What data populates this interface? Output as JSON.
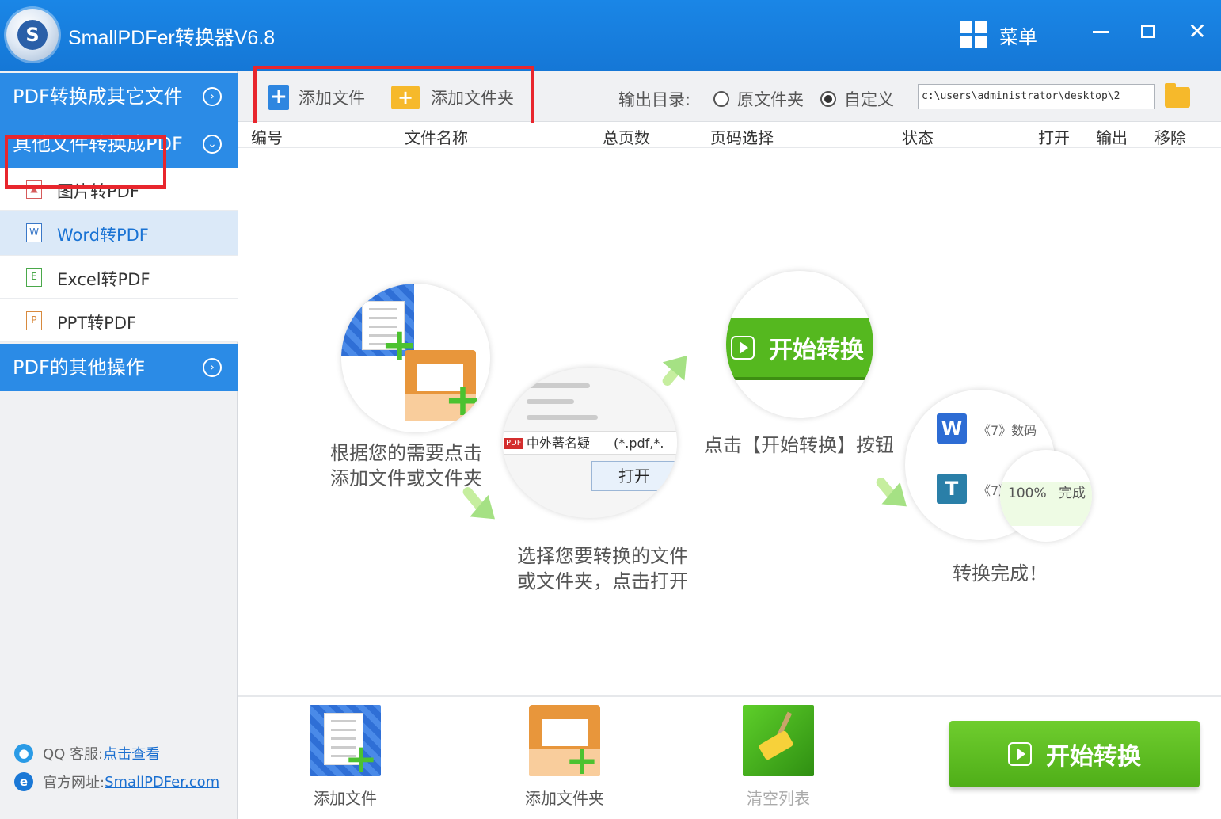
{
  "app": {
    "title": "SmallPDFer转换器V6.8",
    "logo_letter": "S",
    "menu_label": "菜单",
    "minimize": "",
    "maximize": "",
    "close": "✕"
  },
  "sidebar": {
    "categories": [
      {
        "label": "PDF转换成其它文件",
        "chevron": "›"
      },
      {
        "label": "其他文件转换成PDF",
        "chevron": "⌄"
      },
      {
        "label": "PDF的其他操作",
        "chevron": "›"
      }
    ],
    "items": [
      {
        "label": "图片转PDF",
        "icon": "image-file-icon"
      },
      {
        "label": "Word转PDF",
        "icon": "word-file-icon",
        "selected": true
      },
      {
        "label": "Excel转PDF",
        "icon": "excel-file-icon"
      },
      {
        "label": "PPT转PDF",
        "icon": "ppt-file-icon"
      }
    ],
    "footer": {
      "qq_label": "QQ 客服:",
      "qq_link": "点击查看",
      "site_label": "官方网址:",
      "site_link": "SmallPDFer.com"
    }
  },
  "toolbar": {
    "add_file": "添加文件",
    "add_folder": "添加文件夹",
    "output_label": "输出目录:",
    "radio_original": "原文件夹",
    "radio_custom": "自定义",
    "selected_radio": "自定义",
    "output_path": "c:\\users\\administrator\\desktop\\2"
  },
  "table": {
    "columns": [
      "编号",
      "文件名称",
      "总页数",
      "页码选择",
      "状态",
      "打开",
      "输出",
      "移除"
    ]
  },
  "guide": {
    "step1": [
      "根据您的需要点击",
      "添加文件或文件夹"
    ],
    "step2": [
      "选择您要转换的文件",
      "或文件夹，点击打开"
    ],
    "step3": "点击【开始转换】按钮",
    "step4": "转换完成！",
    "start_label": "开始转换",
    "dialog_filename": "中外著名疑",
    "dialog_filter": "(*.pdf,*.",
    "dialog_open": "打开",
    "pdf_badge": "PDF",
    "result_label": "《7》数码",
    "result_label2": "《7》",
    "result_progress": "100%",
    "result_done": "完成",
    "w_letter": "W",
    "t_letter": "T"
  },
  "bottom": {
    "add_file": "添加文件",
    "add_folder": "添加文件夹",
    "clear_list": "清空列表",
    "start": "开始转换"
  }
}
